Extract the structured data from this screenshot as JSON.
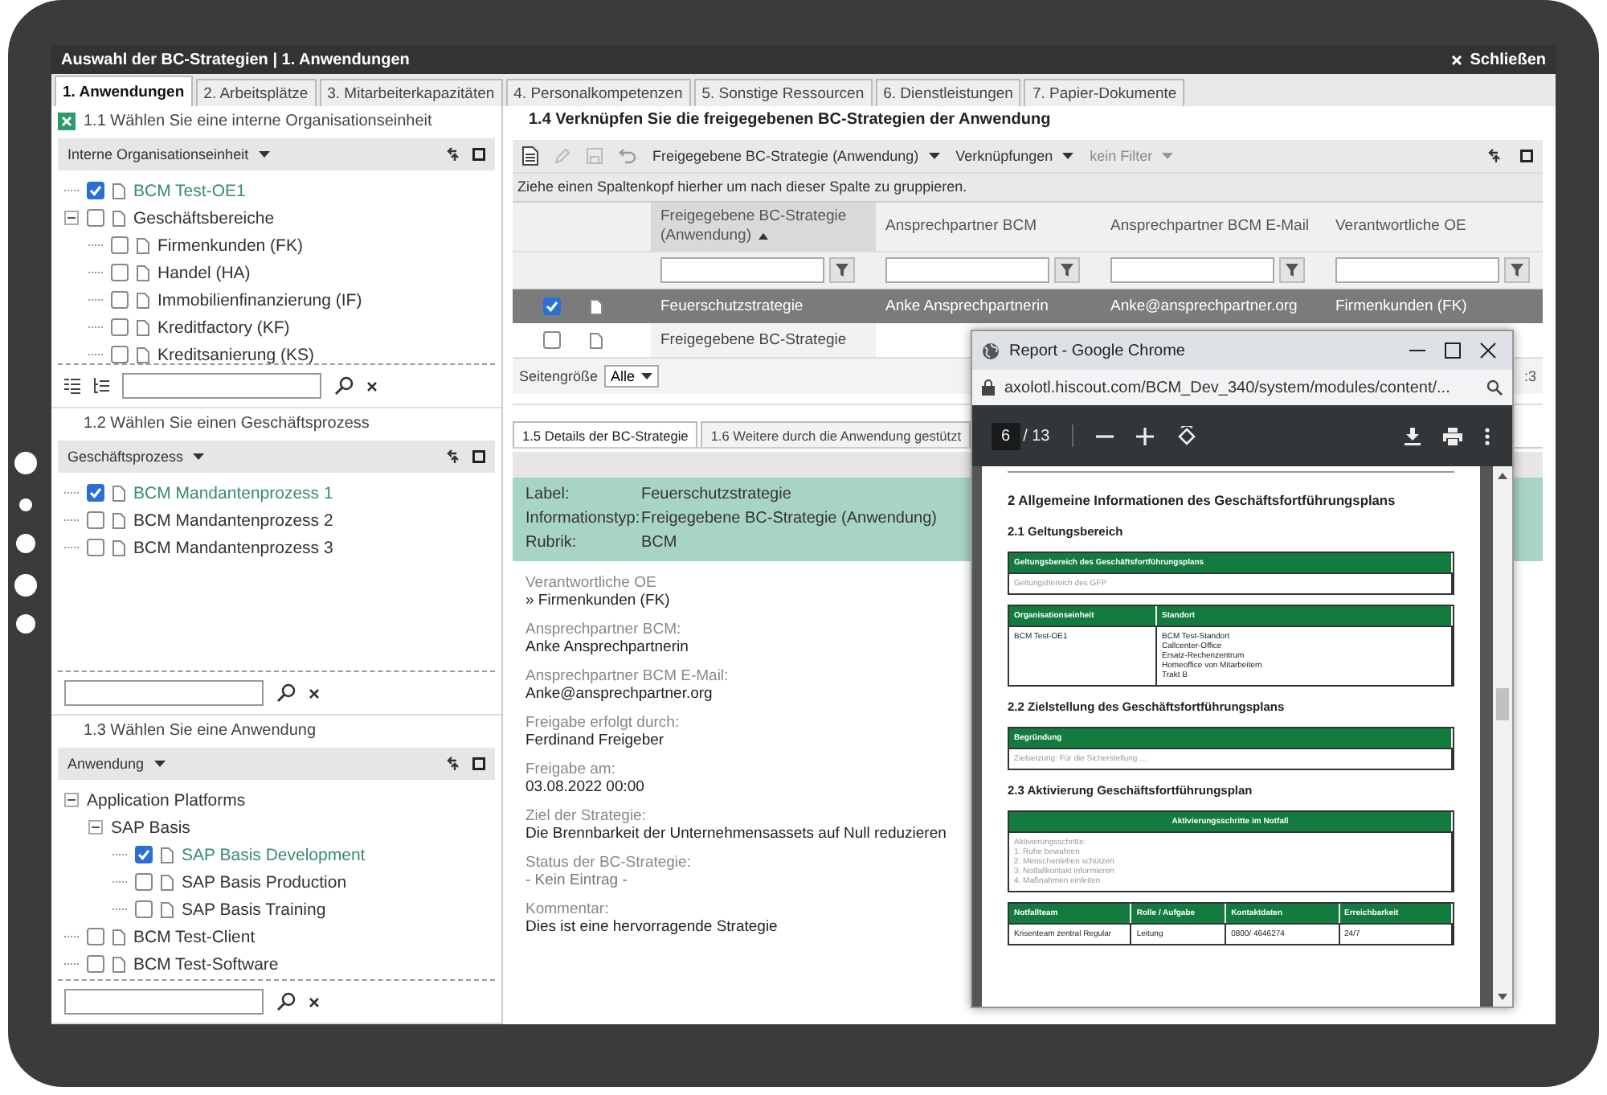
{
  "window": {
    "title": "Auswahl der BC-Strategien | 1. Anwendungen",
    "close_label": "Schließen"
  },
  "tabs": [
    {
      "label": "1. Anwendungen",
      "selected": true
    },
    {
      "label": "2. Arbeitsplätze",
      "selected": false
    },
    {
      "label": "3. Mitarbeiterkapazitäten",
      "selected": false
    },
    {
      "label": "4. Personalkompetenzen",
      "selected": false
    },
    {
      "label": "5. Sonstige Ressourcen",
      "selected": false
    },
    {
      "label": "6. Dienstleistungen",
      "selected": false
    },
    {
      "label": "7. Papier-Dokumente",
      "selected": false
    }
  ],
  "org_panel": {
    "title": "1.1 Wählen Sie eine interne Organisationseinheit",
    "dropdown": "Interne Organisationseinheit",
    "tree": [
      {
        "label": "BCM Test-OE1",
        "checked": true
      },
      {
        "label": "Geschäftsbereiche",
        "checked": false,
        "expanded": true,
        "children": [
          {
            "label": "Firmenkunden (FK)",
            "checked": false
          },
          {
            "label": "Handel (HA)",
            "checked": false
          },
          {
            "label": "Immobilienfinanzierung (IF)",
            "checked": false
          },
          {
            "label": "Kreditfactory (KF)",
            "checked": false
          },
          {
            "label": "Kreditsanierung (KS)",
            "checked": false
          }
        ]
      }
    ]
  },
  "process_panel": {
    "title": "1.2 Wählen Sie einen Geschäftsprozess",
    "dropdown": "Geschäftsprozess",
    "tree": [
      {
        "label": "BCM Mandantenprozess 1",
        "checked": true
      },
      {
        "label": "BCM Mandantenprozess 2",
        "checked": false
      },
      {
        "label": "BCM Mandantenprozess 3",
        "checked": false
      }
    ]
  },
  "app_panel": {
    "title": "1.3 Wählen Sie eine Anwendung",
    "dropdown": "Anwendung",
    "tree": [
      {
        "label": "Application Platforms",
        "expanded": true,
        "children": [
          {
            "label": "SAP Basis",
            "expanded": true,
            "children": [
              {
                "label": "SAP Basis Development",
                "checked": true
              },
              {
                "label": "SAP Basis Production",
                "checked": false
              },
              {
                "label": "SAP Basis Training",
                "checked": false
              }
            ]
          }
        ]
      },
      {
        "label": "BCM Test-Client",
        "checked": false
      },
      {
        "label": "BCM Test-Software",
        "checked": false
      }
    ]
  },
  "strategies": {
    "title": "1.4 Verknüpfen Sie die freigegebenen BC-Strategien der Anwendung",
    "menus": [
      {
        "label": "Freigegebene BC-Strategie (Anwendung)",
        "disabled": false
      },
      {
        "label": "Verknüpfungen",
        "disabled": false
      },
      {
        "label": "kein Filter",
        "disabled": true
      }
    ],
    "group_hint": "Ziehe einen Spaltenkopf hierher um nach dieser Spalte zu gruppieren.",
    "columns": [
      {
        "label": "Freigegebene BC-Strategie (Anwendung)",
        "sorted": true
      },
      {
        "label": "Ansprechpartner BCM",
        "sorted": false
      },
      {
        "label": "Ansprechpartner BCM E-Mail",
        "sorted": false
      },
      {
        "label": "Verantwortliche OE",
        "sorted": false
      }
    ],
    "rows": [
      {
        "selected": true,
        "cells": [
          "Feuerschutzstrategie",
          "Anke Ansprechpartnerin",
          "Anke@ansprechpartner.org",
          "Firmenkunden (FK)"
        ]
      },
      {
        "selected": false,
        "cells": [
          "Freigegebene BC-Strategie"
        ]
      }
    ],
    "page_size_label": "Seitengröße",
    "page_size": "Alle",
    "pager_text": ":3"
  },
  "details": {
    "tabs": [
      {
        "label": "1.5 Details der BC-Strategie",
        "selected": true
      },
      {
        "label": "1.6 Weitere durch die Anwendung gestützt",
        "selected": false
      }
    ],
    "summary": [
      {
        "label": "Label:",
        "value": "Feuerschutzstrategie"
      },
      {
        "label": "Informationstyp:",
        "value": "Freigegebene BC-Strategie (Anwendung)"
      },
      {
        "label": "Rubrik:",
        "value": "BCM"
      }
    ],
    "fields": [
      {
        "label": "Verantwortliche OE",
        "value": "» Firmenkunden (FK)"
      },
      {
        "label": "Ansprechpartner BCM:",
        "value": "Anke Ansprechpartnerin"
      },
      {
        "label": "Ansprechpartner BCM E-Mail:",
        "value": "Anke@ansprechpartner.org"
      },
      {
        "label": "Freigabe erfolgt durch:",
        "value": "Ferdinand Freigeber"
      },
      {
        "label": "Freigabe am:",
        "value": "03.08.2022 00:00"
      },
      {
        "label": "Ziel der Strategie:",
        "value": "Die Brennbarkeit der Unternehmensassets auf Null reduzieren"
      },
      {
        "label": "Status der BC-Strategie:",
        "value": "- Kein Eintrag -",
        "muted": true
      },
      {
        "label": "Kommentar:",
        "value": "Dies ist eine hervorragende Strategie"
      }
    ]
  },
  "browser_popup": {
    "title": "Report - Google Chrome",
    "url": "axolotl.hiscout.com/BCM_Dev_340/system/modules/content/...",
    "page": "6",
    "page_total": "/ 13",
    "blocks": [
      {
        "kind": "heading",
        "text": "2 Allgemeine Informationen des Geschäftsfortführungsplans"
      },
      {
        "kind": "subheading",
        "text": "2.1 Geltungsbereich"
      },
      {
        "kind": "table",
        "centered": false,
        "headers": [
          "Geltungsbereich des Geschäftsfortführungsplans"
        ],
        "rows": [
          {
            "muted": true,
            "cells": [
              [
                "Geltungsbereich des GFP"
              ]
            ]
          }
        ]
      },
      {
        "kind": "table",
        "centered": false,
        "headers": [
          "Organisationseinheit",
          "Standort"
        ],
        "rows": [
          {
            "muted": false,
            "cells": [
              [
                "BCM Test-OE1"
              ],
              [
                "BCM Test-Standort",
                "Callcenter-Office",
                "Ersatz-Rechenzentrum",
                "Homeoffice von Mitarbeitern",
                "Trakt B"
              ]
            ]
          }
        ]
      },
      {
        "kind": "subheading",
        "text": "2.2 Zielstellung des Geschäftsfortführungsplans"
      },
      {
        "kind": "table",
        "centered": false,
        "headers": [
          "Begründung"
        ],
        "rows": [
          {
            "muted": true,
            "cells": [
              [
                "Zielsetzung: Für die Sicherstellung ..."
              ]
            ]
          }
        ]
      },
      {
        "kind": "subheading",
        "text": "2.3 Aktivierung Geschäftsfortführungsplan"
      },
      {
        "kind": "table",
        "centered": true,
        "headers": [
          "Aktivierungsschritte im Notfall"
        ],
        "rows": [
          {
            "muted": true,
            "cells": [
              [
                "Aktivierungsschritte:",
                "1. Ruhe bewahren",
                "2. Menschenleben schützen",
                "3. Notfallkontakt informieren",
                "4. Maßnahmen einleiten"
              ]
            ]
          }
        ]
      },
      {
        "kind": "table",
        "centered": false,
        "headers": [
          "Notfallteam",
          "Rolle / Aufgabe",
          "Kontaktdaten",
          "Erreichbarkeit"
        ],
        "rows": [
          {
            "muted": false,
            "cells": [
              [
                "Krisenteam zentral Regular"
              ],
              [
                "Leitung"
              ],
              [
                "0800/ 4646274"
              ],
              [
                "24/7"
              ]
            ]
          }
        ]
      }
    ]
  }
}
